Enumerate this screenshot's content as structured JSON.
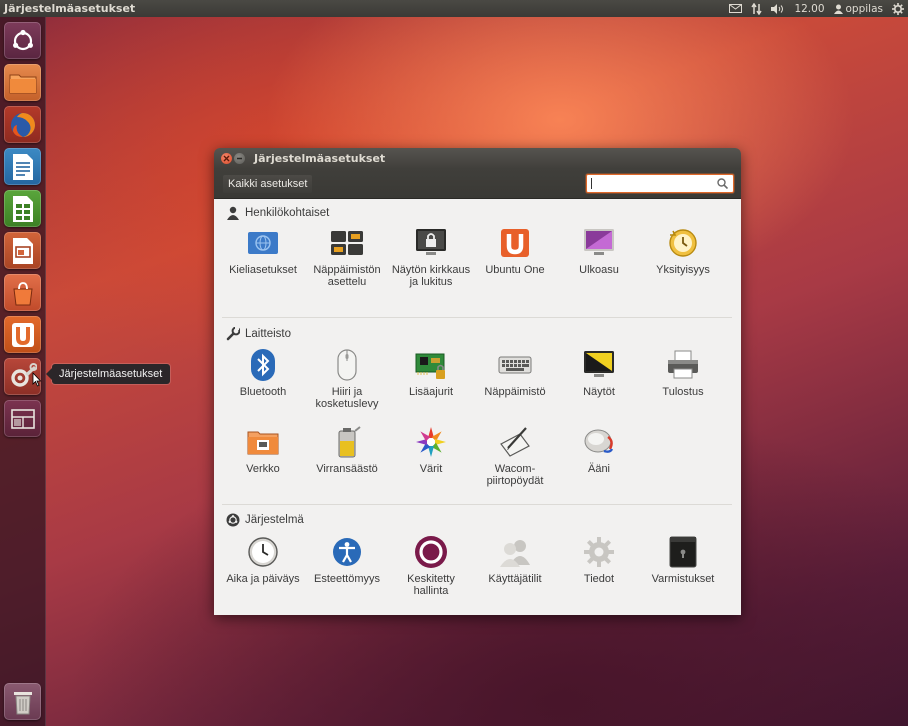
{
  "panel": {
    "app_title": "Järjestelmäasetukset",
    "time": "12.00",
    "user": "oppilas"
  },
  "launcher": {
    "items": [
      {
        "name": "dash-home",
        "icon": "ubuntu-logo-icon"
      },
      {
        "name": "files",
        "icon": "folder-icon"
      },
      {
        "name": "firefox",
        "icon": "firefox-icon"
      },
      {
        "name": "writer",
        "icon": "libreoffice-writer-icon"
      },
      {
        "name": "calc",
        "icon": "libreoffice-calc-icon"
      },
      {
        "name": "impress",
        "icon": "libreoffice-impress-icon"
      },
      {
        "name": "software-center",
        "icon": "shopping-bag-icon"
      },
      {
        "name": "ubuntu-one",
        "icon": "ubuntu-one-icon"
      },
      {
        "name": "system-settings",
        "icon": "settings-wrench-icon"
      },
      {
        "name": "workspaces",
        "icon": "workspace-switcher-icon"
      },
      {
        "name": "trash",
        "icon": "trash-icon"
      }
    ],
    "tooltip": "Järjestelmäasetukset"
  },
  "window": {
    "title": "Järjestelmäasetukset",
    "all_settings_label": "Kaikki asetukset",
    "search_placeholder": ""
  },
  "sections": [
    {
      "title": "Henkilökohtaiset",
      "icon": "person-icon",
      "items": [
        {
          "label": "Kieliasetukset",
          "icon": "language-flag-icon"
        },
        {
          "label": "Näppäimistön asettelu",
          "icon": "keyboard-layout-icon"
        },
        {
          "label": "Näytön kirkkaus ja lukitus",
          "icon": "screen-lock-icon"
        },
        {
          "label": "Ubuntu One",
          "icon": "ubuntu-one-icon"
        },
        {
          "label": "Ulkoasu",
          "icon": "appearance-monitor-icon"
        },
        {
          "label": "Yksityisyys",
          "icon": "privacy-clock-icon"
        }
      ]
    },
    {
      "title": "Laitteisto",
      "icon": "wrench-icon",
      "items": [
        {
          "label": "Bluetooth",
          "icon": "bluetooth-icon"
        },
        {
          "label": "Hiiri ja kosketuslevy",
          "icon": "mouse-icon"
        },
        {
          "label": "Lisäajurit",
          "icon": "driver-board-icon"
        },
        {
          "label": "Näppäimistö",
          "icon": "keyboard-icon"
        },
        {
          "label": "Näytöt",
          "icon": "display-icon"
        },
        {
          "label": "Tulostus",
          "icon": "printer-icon"
        },
        {
          "label": "Verkko",
          "icon": "network-folder-icon"
        },
        {
          "label": "Virransäästö",
          "icon": "battery-icon"
        },
        {
          "label": "Värit",
          "icon": "color-star-icon"
        },
        {
          "label": "Wacom-piirtopöydät",
          "icon": "tablet-pen-icon"
        },
        {
          "label": "Ääni",
          "icon": "speaker-icon"
        }
      ]
    },
    {
      "title": "Järjestelmä",
      "icon": "ubuntu-logo-icon",
      "items": [
        {
          "label": "Aika ja päiväys",
          "icon": "clock-icon"
        },
        {
          "label": "Esteettömyys",
          "icon": "accessibility-icon"
        },
        {
          "label": "Keskitetty hallinta",
          "icon": "landscape-ring-icon"
        },
        {
          "label": "Käyttäjätilit",
          "icon": "users-icon"
        },
        {
          "label": "Tiedot",
          "icon": "gear-icon"
        },
        {
          "label": "Varmistukset",
          "icon": "backup-safe-icon"
        }
      ]
    }
  ]
}
